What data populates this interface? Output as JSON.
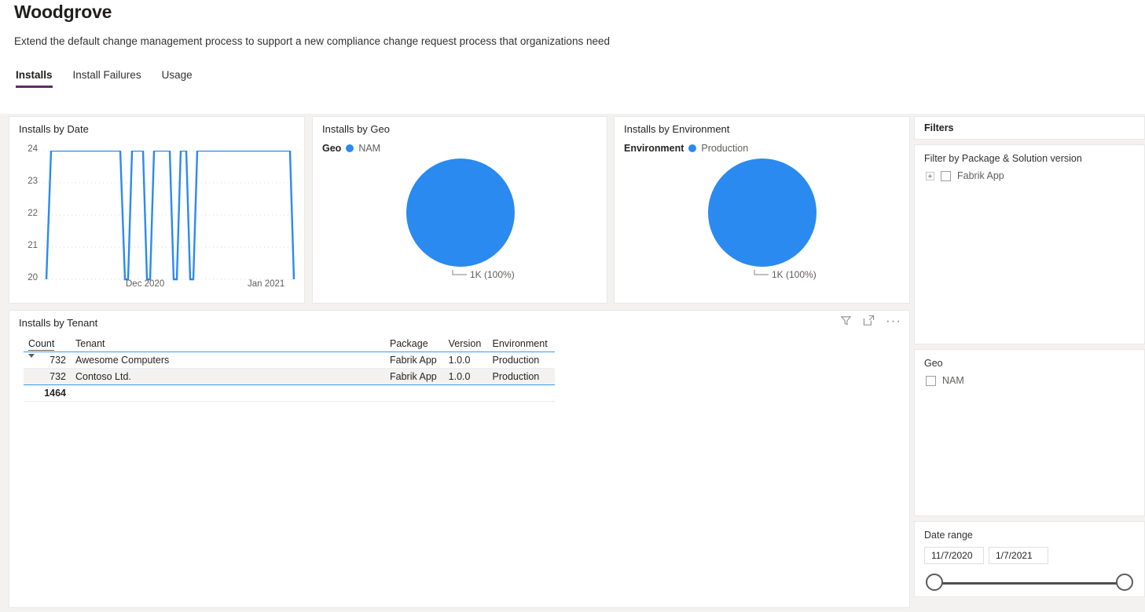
{
  "header": {
    "title": "Woodgrove",
    "subtitle": "Extend the default change management process to support a new compliance change request process that organizations need"
  },
  "tabs": [
    {
      "label": "Installs",
      "active": true
    },
    {
      "label": "Install Failures",
      "active": false
    },
    {
      "label": "Usage",
      "active": false
    }
  ],
  "visuals": {
    "line": {
      "title": "Installs by Date"
    },
    "geo": {
      "title": "Installs by Geo"
    },
    "environment": {
      "title": "Installs by Environment"
    },
    "tenant": {
      "title": "Installs by Tenant"
    }
  },
  "table": {
    "columns": [
      "Count",
      "Tenant",
      "Package",
      "Version",
      "Environment"
    ],
    "sort_column": "Count",
    "sort_direction": "descending",
    "rows": [
      {
        "count": "732",
        "tenant": "Awesome Computers",
        "package": "Fabrik App",
        "version": "1.0.0",
        "environment": "Production"
      },
      {
        "count": "732",
        "tenant": "Contoso Ltd.",
        "package": "Fabrik App",
        "version": "1.0.0",
        "environment": "Production"
      }
    ],
    "total": "1464",
    "icons": [
      "filter-icon",
      "focus-mode-icon",
      "more-options-icon"
    ]
  },
  "filters": {
    "pane_title": "Filters",
    "package_filter": {
      "title": "Filter by Package & Solution version",
      "items": [
        {
          "label": "Fabrik App",
          "checked": false,
          "expandable": true
        }
      ]
    },
    "geo_filter": {
      "title": "Geo",
      "items": [
        {
          "label": "NAM",
          "checked": false
        }
      ]
    },
    "date_filter": {
      "title": "Date range",
      "start": "11/7/2020",
      "end": "1/7/2021"
    }
  },
  "colors": {
    "accent_blue": "#2a8af0",
    "tab_underline": "#5c2d63",
    "canvas_bg": "#f3f2f1",
    "grid_line": "#2f9cf4"
  },
  "chart_data": [
    {
      "type": "line",
      "title": "Installs by Date",
      "xlabel": "",
      "ylabel": "",
      "ylim": [
        20,
        24
      ],
      "yticks": [
        20,
        21,
        22,
        23,
        24
      ],
      "xticks": [
        "Dec 2020",
        "Jan 2021"
      ],
      "grid": true,
      "series": [
        {
          "name": "Installs",
          "values": [
            20,
            24,
            24,
            24,
            24,
            24,
            24,
            24,
            20,
            24,
            24,
            20,
            24,
            24,
            24,
            20,
            24,
            20,
            24,
            24,
            24,
            24,
            24,
            24,
            24,
            24,
            24,
            24,
            24,
            24,
            24,
            24,
            24,
            24,
            20
          ]
        }
      ]
    },
    {
      "type": "pie",
      "title": "Installs by Geo",
      "legend_title": "Geo",
      "legend_position": "top",
      "labels": [
        "NAM"
      ],
      "values": [
        1464
      ],
      "data_labels": [
        "1K (100%)"
      ],
      "percentages": [
        100
      ]
    },
    {
      "type": "pie",
      "title": "Installs by Environment",
      "legend_title": "Environment",
      "legend_position": "top",
      "labels": [
        "Production"
      ],
      "values": [
        1464
      ],
      "data_labels": [
        "1K (100%)"
      ],
      "percentages": [
        100
      ]
    },
    {
      "type": "table",
      "title": "Installs by Tenant",
      "columns": [
        "Count",
        "Tenant",
        "Package",
        "Version",
        "Environment"
      ],
      "rows": [
        [
          "732",
          "Awesome Computers",
          "Fabrik App",
          "1.0.0",
          "Production"
        ],
        [
          "732",
          "Contoso Ltd.",
          "Fabrik App",
          "1.0.0",
          "Production"
        ]
      ],
      "total_row": [
        "1464",
        "",
        "",
        "",
        ""
      ]
    }
  ]
}
